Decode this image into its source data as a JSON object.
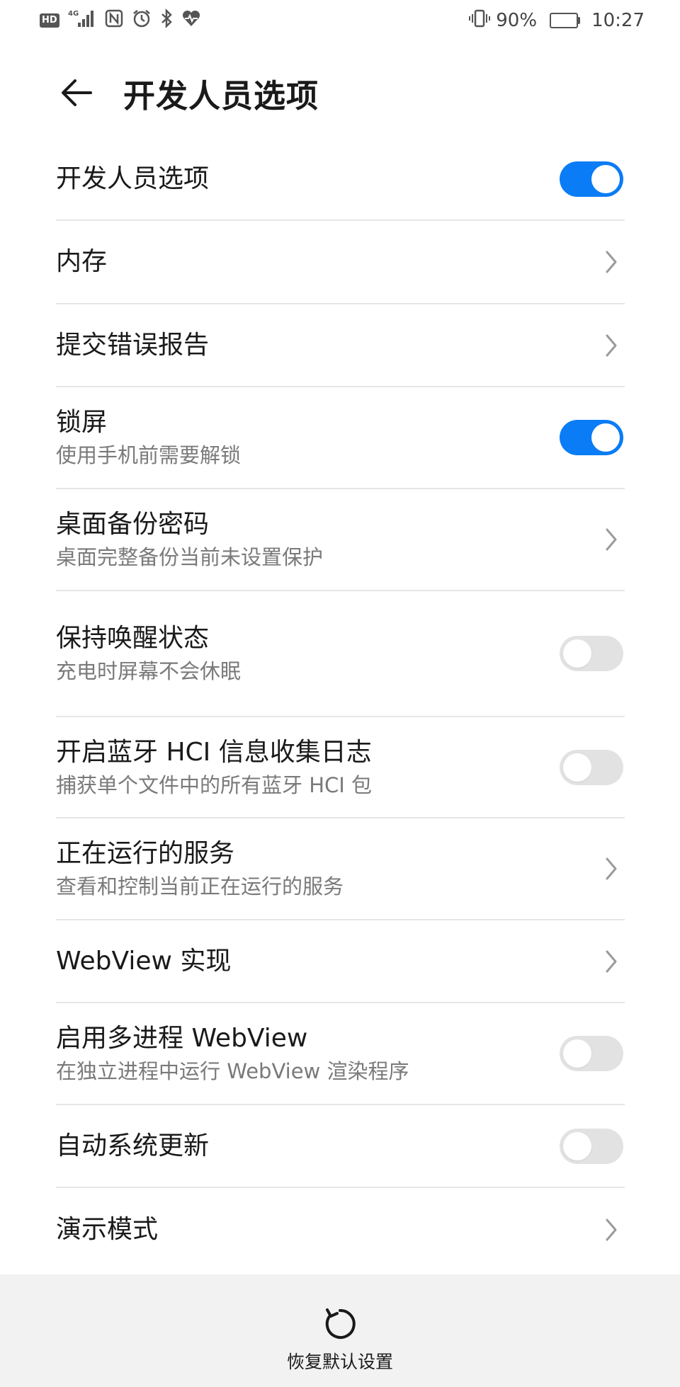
{
  "status_bar": {
    "hd": "HD",
    "network": "4G",
    "battery_percent": "90%",
    "battery_level": 0.9,
    "time": "10:27",
    "icons": [
      "hd-icon",
      "signal-icon",
      "nfc-icon",
      "alarm-icon",
      "bluetooth-icon",
      "health-icon",
      "vibrate-icon",
      "battery-icon"
    ]
  },
  "header": {
    "title": "开发人员选项",
    "back_icon": "arrow-left-icon"
  },
  "settings": [
    {
      "title": "开发人员选项",
      "subtitle": "",
      "control": "toggle",
      "on": true
    },
    {
      "title": "内存",
      "subtitle": "",
      "control": "chevron"
    },
    {
      "title": "提交错误报告",
      "subtitle": "",
      "control": "chevron"
    },
    {
      "title": "锁屏",
      "subtitle": "使用手机前需要解锁",
      "control": "toggle",
      "on": true
    },
    {
      "title": "桌面备份密码",
      "subtitle": "桌面完整备份当前未设置保护",
      "control": "chevron"
    },
    {
      "title": "保持唤醒状态",
      "subtitle": "充电时屏幕不会休眠",
      "control": "toggle",
      "on": false
    },
    {
      "title": "开启蓝牙 HCI 信息收集日志",
      "subtitle": "捕获单个文件中的所有蓝牙 HCI 包",
      "control": "toggle",
      "on": false
    },
    {
      "title": "正在运行的服务",
      "subtitle": "查看和控制当前正在运行的服务",
      "control": "chevron"
    },
    {
      "title": "WebView 实现",
      "subtitle": "",
      "control": "chevron"
    },
    {
      "title": "启用多进程 WebView",
      "subtitle": "在独立进程中运行 WebView 渲染程序",
      "control": "toggle",
      "on": false
    },
    {
      "title": "自动系统更新",
      "subtitle": "",
      "control": "toggle",
      "on": false
    },
    {
      "title": "演示模式",
      "subtitle": "",
      "control": "chevron"
    }
  ],
  "footer": {
    "label": "恢复默认设置",
    "icon": "reset-icon"
  },
  "colors": {
    "accent": "#0a7cf5",
    "toggle_off": "#e2e2e2",
    "divider": "#e6e6e6",
    "subtitle": "#7a7a7a",
    "footer_bg": "#f2f2f2"
  }
}
